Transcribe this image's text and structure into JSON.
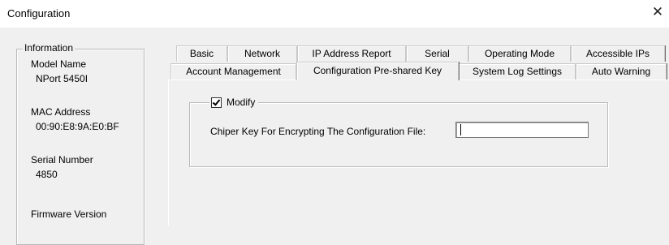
{
  "window": {
    "title": "Configuration",
    "close_symbol": "✕"
  },
  "info": {
    "legend": "Information",
    "model_label": "Model Name",
    "model_value": "NPort 5450I",
    "mac_label": "MAC Address",
    "mac_value": "00:90:E8:9A:E0:BF",
    "serial_label": "Serial Number",
    "serial_value": "4850",
    "firmware_label": "Firmware Version"
  },
  "tabs": {
    "row1": [
      "Basic",
      "Network",
      "IP Address Report",
      "Serial",
      "Operating Mode",
      "Accessible IPs"
    ],
    "row2": [
      "Account Management",
      "Configuration Pre-shared Key",
      "System Log Settings",
      "Auto Warning"
    ],
    "active": "Configuration Pre-shared Key"
  },
  "panel": {
    "modify_label": "Modify",
    "modify_checked": true,
    "key_label": "Chiper Key For Encrypting The Configuration File:",
    "key_value": ""
  }
}
